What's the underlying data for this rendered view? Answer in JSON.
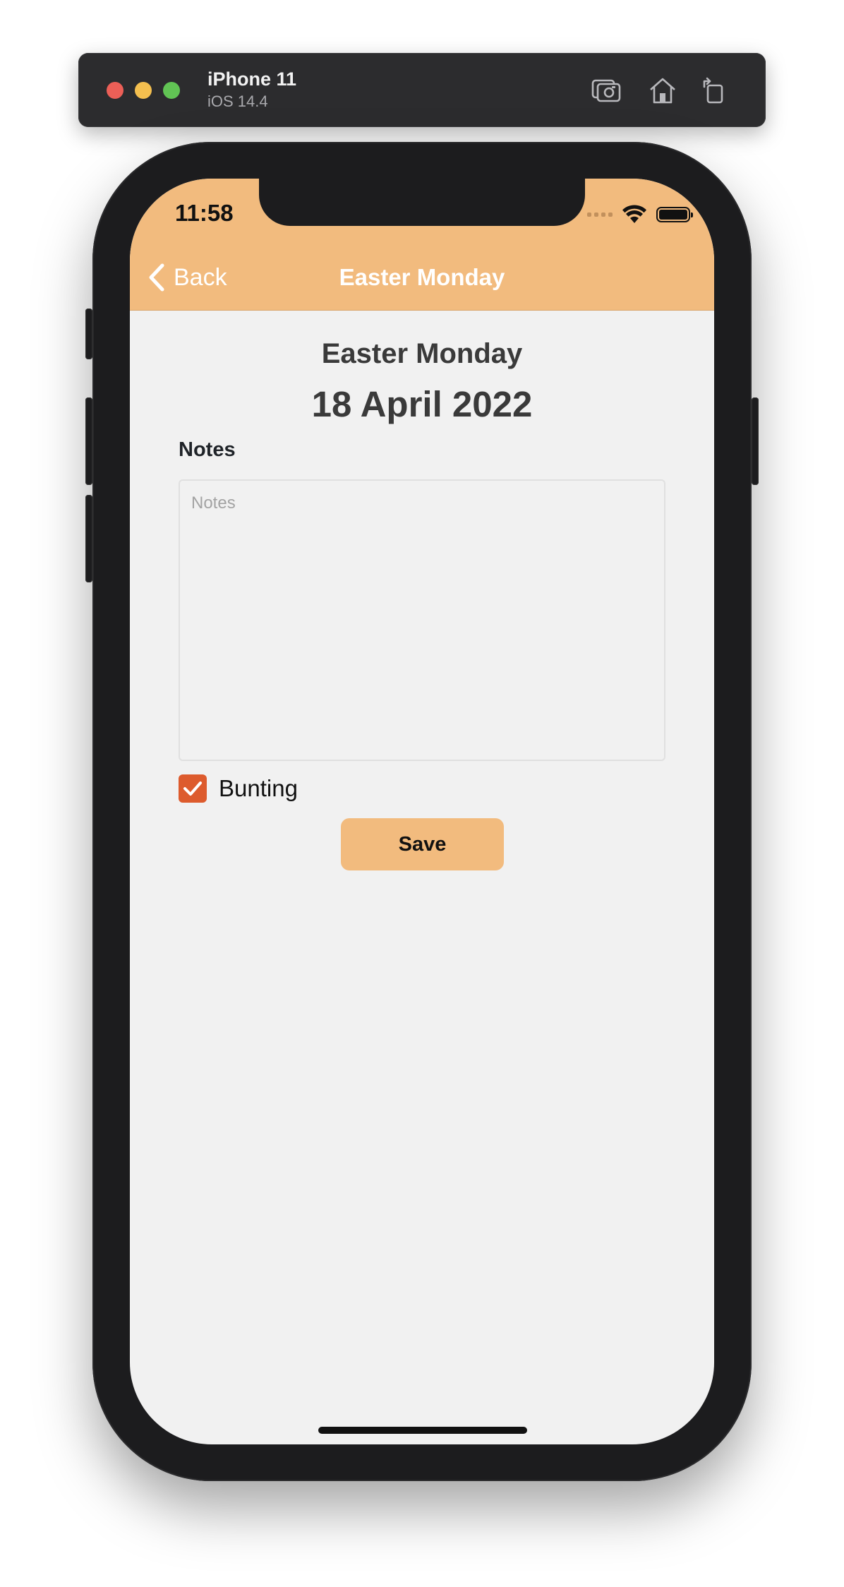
{
  "simulator": {
    "device_name": "iPhone 11",
    "os_version": "iOS 14.4",
    "toolbar_icons": [
      "screenshot-icon",
      "home-icon",
      "rotate-icon"
    ]
  },
  "status_bar": {
    "time": "11:58"
  },
  "nav": {
    "back_label": "Back",
    "title": "Easter Monday"
  },
  "holiday": {
    "name": "Easter Monday",
    "date": "18 April 2022"
  },
  "notes": {
    "label": "Notes",
    "placeholder": "Notes",
    "value": ""
  },
  "bunting": {
    "label": "Bunting",
    "checked": true
  },
  "save_button": {
    "label": "Save"
  },
  "colors": {
    "accent": "#f2bb7e",
    "checkbox": "#dd5b2d",
    "background": "#f1f1f1",
    "text": "#3a3a3a"
  }
}
